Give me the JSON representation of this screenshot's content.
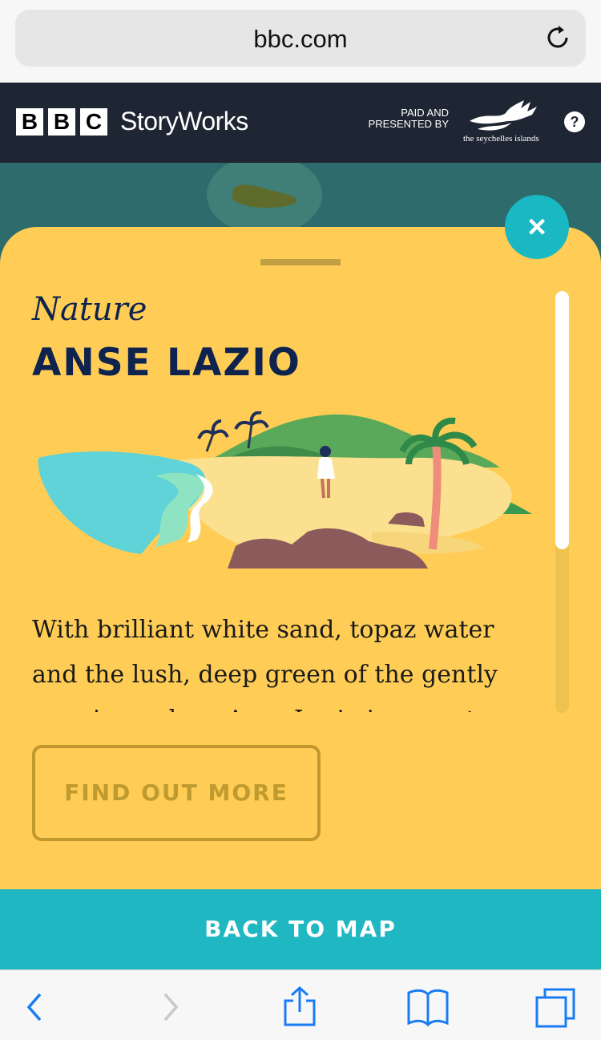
{
  "browser": {
    "url": "bbc.com",
    "reload_icon": "reload-icon"
  },
  "header": {
    "bbc_letters": [
      "B",
      "B",
      "C"
    ],
    "brand": "StoryWorks",
    "sponsor_line1": "PAID AND",
    "sponsor_line2": "PRESENTED BY",
    "sponsor_name": "the seychelles islands",
    "help_label": "?"
  },
  "card": {
    "category": "Nature",
    "title": "ANSE LAZIO",
    "body": "With brilliant white sand, topaz water and the lush, deep green of the gently swaying palms, Anse Lazio is a most",
    "cta_label": "FIND OUT MORE",
    "close_label": "×",
    "scroll_position": 0
  },
  "footer": {
    "back_label": "BACK TO MAP"
  },
  "toolbar": {
    "icons": [
      "back-icon",
      "forward-icon",
      "share-icon",
      "bookmarks-icon",
      "tabs-icon"
    ]
  },
  "colors": {
    "card": "#ffcd55",
    "navy": "#0f234f",
    "teal": "#1fb7c1",
    "header": "#1e2633",
    "map": "#2d6b6c"
  }
}
